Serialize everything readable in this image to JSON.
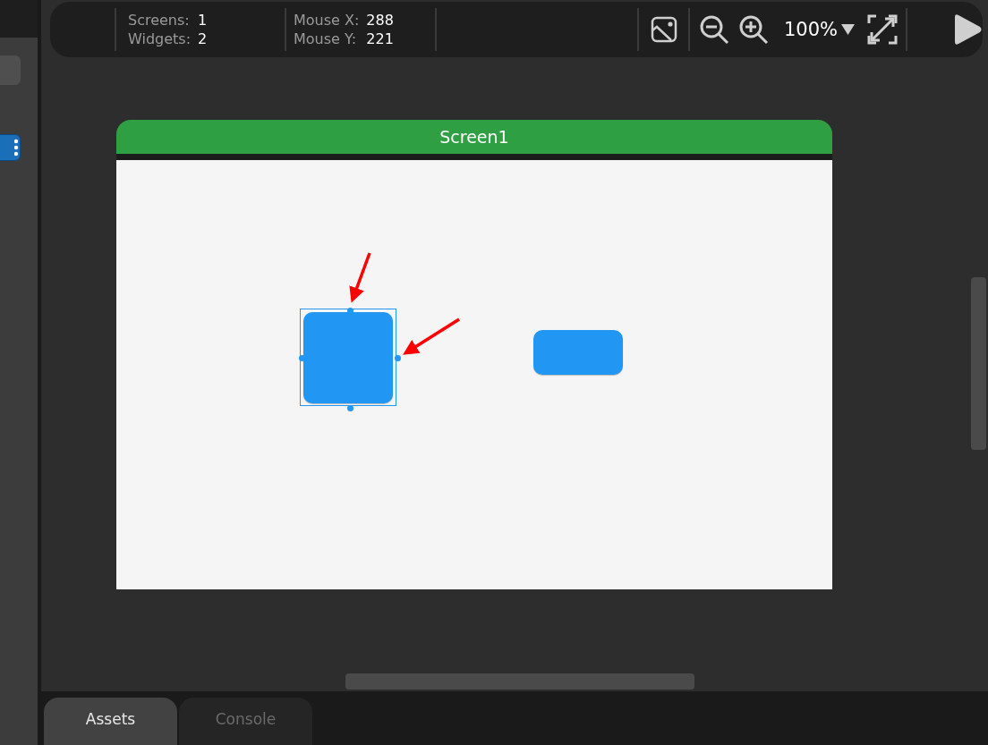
{
  "toolbar": {
    "stats": [
      {
        "label": "Screens:",
        "value": "1"
      },
      {
        "label": "Widgets:",
        "value": "2"
      },
      {
        "label": "Mouse X:",
        "value": "288"
      },
      {
        "label": "Mouse Y:",
        "value": "221"
      }
    ],
    "zoom": "100%"
  },
  "screen": {
    "title": "Screen1",
    "widgets": [
      {
        "kind": "square",
        "selected": true
      },
      {
        "kind": "wide",
        "selected": false
      }
    ]
  },
  "bottom_tabs": [
    {
      "label": "Assets",
      "selected": true
    },
    {
      "label": "Console",
      "selected": false
    }
  ]
}
